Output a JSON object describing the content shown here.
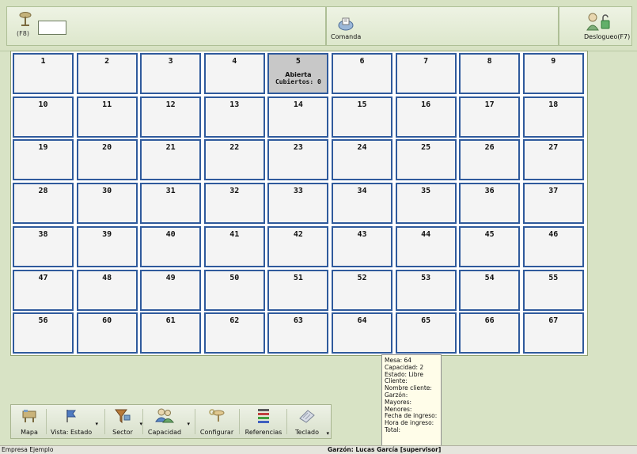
{
  "header": {
    "shortcut_label": "(F8)",
    "table_input_value": "",
    "command_label": "Comanda",
    "logout_label": "Deslogueo(F7)"
  },
  "tables": [
    {
      "num": "1"
    },
    {
      "num": "2"
    },
    {
      "num": "3"
    },
    {
      "num": "4"
    },
    {
      "num": "5",
      "state": "Abierta",
      "covers": "Cubiertos: 0"
    },
    {
      "num": "6"
    },
    {
      "num": "7"
    },
    {
      "num": "8"
    },
    {
      "num": "9"
    },
    {
      "num": "10"
    },
    {
      "num": "11"
    },
    {
      "num": "12"
    },
    {
      "num": "13"
    },
    {
      "num": "14"
    },
    {
      "num": "15"
    },
    {
      "num": "16"
    },
    {
      "num": "17"
    },
    {
      "num": "18"
    },
    {
      "num": "19"
    },
    {
      "num": "20"
    },
    {
      "num": "21"
    },
    {
      "num": "22"
    },
    {
      "num": "23"
    },
    {
      "num": "24"
    },
    {
      "num": "25"
    },
    {
      "num": "26"
    },
    {
      "num": "27"
    },
    {
      "num": "28"
    },
    {
      "num": "30"
    },
    {
      "num": "31"
    },
    {
      "num": "32"
    },
    {
      "num": "33"
    },
    {
      "num": "34"
    },
    {
      "num": "35"
    },
    {
      "num": "36"
    },
    {
      "num": "37"
    },
    {
      "num": "38"
    },
    {
      "num": "39"
    },
    {
      "num": "40"
    },
    {
      "num": "41"
    },
    {
      "num": "42"
    },
    {
      "num": "43"
    },
    {
      "num": "44"
    },
    {
      "num": "45"
    },
    {
      "num": "46"
    },
    {
      "num": "47"
    },
    {
      "num": "48"
    },
    {
      "num": "49"
    },
    {
      "num": "50"
    },
    {
      "num": "51"
    },
    {
      "num": "52"
    },
    {
      "num": "53"
    },
    {
      "num": "54"
    },
    {
      "num": "55"
    },
    {
      "num": "56"
    },
    {
      "num": "60"
    },
    {
      "num": "61"
    },
    {
      "num": "62"
    },
    {
      "num": "63"
    },
    {
      "num": "64"
    },
    {
      "num": "65"
    },
    {
      "num": "66"
    },
    {
      "num": "67"
    }
  ],
  "toolbar": {
    "map_label": "Mapa",
    "view_label": "Vista: Estado",
    "sector_label": "Sector",
    "capacity_label": "Capacidad",
    "configure_label": "Configurar",
    "references_label": "Referencias",
    "keyboard_label": "Teclado"
  },
  "tooltip": [
    "Mesa: 64",
    "Capacidad: 2",
    "Estado: Libre",
    "Cliente:",
    "Nombre cliente:",
    "Garzón:",
    "Mayores:",
    "Menores:",
    "Fecha de ingreso:",
    "Hora de ingreso:",
    "Total:"
  ],
  "status": {
    "company": "Empresa Ejemplo",
    "waiter": "Garzón: Lucas García [supervisor]"
  },
  "colors": {
    "cell_border": "#2f5a9c",
    "open_cell": "#c8c8c8",
    "app_bg": "#d8e3c5"
  }
}
